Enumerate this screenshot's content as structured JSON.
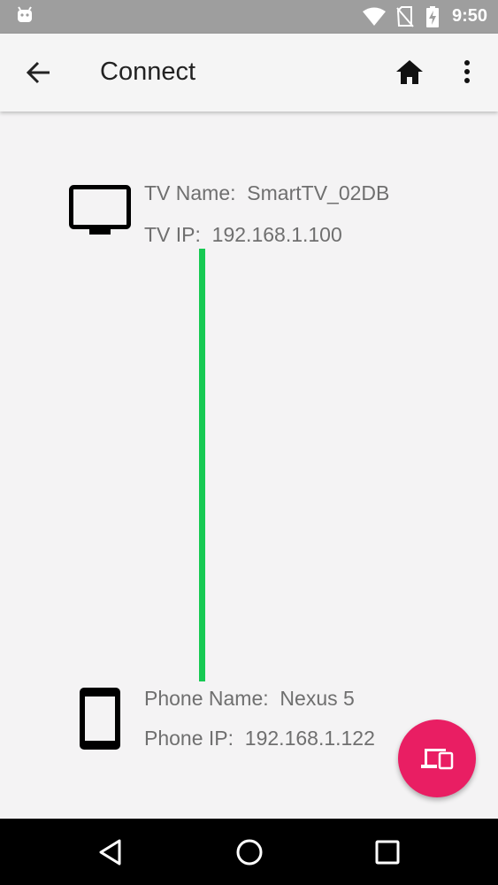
{
  "status_bar": {
    "time": "9:50",
    "icons": [
      "android-icon",
      "wifi-icon",
      "no-sim-icon",
      "battery-charging-icon"
    ]
  },
  "app_bar": {
    "title": "Connect",
    "icons": [
      "arrow-back-icon",
      "home-icon",
      "more-vert-icon"
    ]
  },
  "tv": {
    "name_line": "TV Name:  SmartTV_02DB",
    "ip_line": "TV IP:  192.168.1.100",
    "icon": "tv-icon"
  },
  "phone": {
    "name_line": "Phone Name:  Nexus 5",
    "ip_line": "Phone IP:  192.168.1.122",
    "icon": "smartphone-icon"
  },
  "connection": {
    "status_color": "#16c952"
  },
  "fab": {
    "icon": "devices-icon",
    "color": "#e91e63"
  },
  "nav_bar": {
    "icons": [
      "nav-back-icon",
      "nav-home-icon",
      "nav-recents-icon"
    ]
  }
}
